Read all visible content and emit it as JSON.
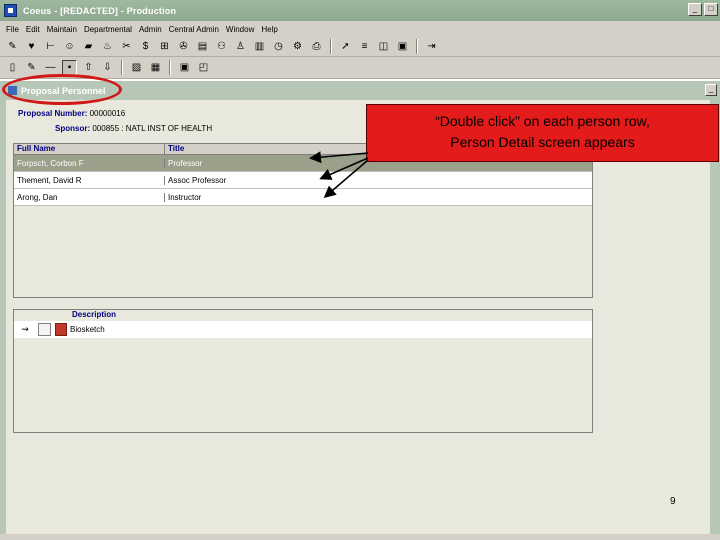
{
  "window": {
    "title": "Coeus - [REDACTED] - Production",
    "controls": [
      "_",
      "□"
    ]
  },
  "menu": [
    "File",
    "Edit",
    "Maintain",
    "Departmental",
    "Admin",
    "Central Admin",
    "Window",
    "Help"
  ],
  "toolbar1": [
    "tb-a",
    "tb-b",
    "tb-c",
    "tb-d",
    "tb-e",
    "tb-f",
    "tb-g",
    "tb-h",
    "tb-i",
    "tb-j",
    "tb-k",
    "tb-l",
    "tb-m",
    "tb-n",
    "tb-o",
    "tb-p",
    "tb-q",
    "tb-r",
    "tb-s",
    "tb-t",
    "tb-u",
    "tb-v",
    "tb-w",
    "tb-x",
    "tb-y"
  ],
  "document": {
    "title": "Proposal Personnel",
    "min_label": "_"
  },
  "proposal": {
    "number_label": "Proposal Number:",
    "number_value": "00000016",
    "sponsor_label": "Sponsor:",
    "sponsor_value": "000855 : NATL INST OF HEALTH"
  },
  "personnel_table": {
    "headers": [
      "Full Name",
      "Title"
    ],
    "rows": [
      {
        "name": "Forpsch, Corbon F",
        "title": "Professor"
      },
      {
        "name": "Thement, David R",
        "title": "Assoc Professor"
      },
      {
        "name": "Arong, Dan",
        "title": "Instructor"
      }
    ]
  },
  "attachments": {
    "header": "Description",
    "rows": [
      {
        "description": "Biosketch"
      }
    ]
  },
  "callout": {
    "line1": "“Double click” on each person row,",
    "line2": "Person Detail screen appears"
  },
  "page_number": "9",
  "colors": {
    "title_bar": "#8fa890",
    "selected_row": "#9aa08a",
    "callout_fill": "#e31b1b",
    "oval_stroke": "#d01818"
  }
}
